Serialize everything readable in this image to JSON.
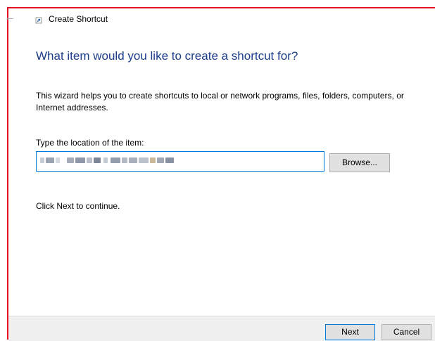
{
  "window": {
    "title": "Create Shortcut",
    "back_icon": "back-arrow-icon",
    "app_icon": "shortcut-icon",
    "accent_border_color": "#e81123"
  },
  "content": {
    "heading": "What item would you like to create a shortcut for?",
    "description": "This wizard helps you to create shortcuts to local or network programs, files, folders, computers, or Internet addresses.",
    "location_label": "Type the location of the item:",
    "location_value": "",
    "location_value_obscured": true,
    "browse_label": "Browse...",
    "continue_text": "Click Next to continue."
  },
  "footer": {
    "next_label": "Next",
    "cancel_label": "Cancel"
  },
  "colors": {
    "heading": "#1c3e8a",
    "input_focus_border": "#0078d7",
    "footer_background": "#f0f0f0",
    "button_background": "#e1e1e1"
  }
}
